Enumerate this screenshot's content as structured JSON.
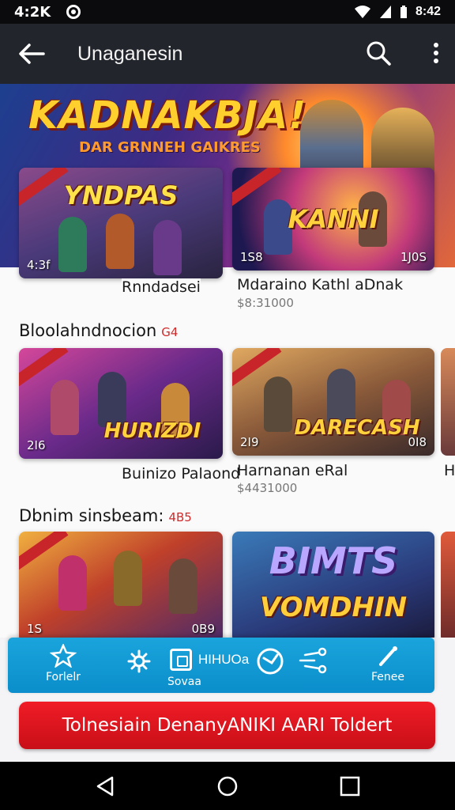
{
  "status_bar": {
    "time": "4:2K",
    "clock": "8:42"
  },
  "app_bar": {
    "title": "Unaganesin"
  },
  "hero": {
    "title": "KADNAKBJA!",
    "subtitle": "DAR GRNNEH GAIKRES"
  },
  "featured": {
    "cards": [
      {
        "logo": "YNDPAS",
        "left_num": "4:3f",
        "right_num": "",
        "name": "Rnndadsei",
        "price": ""
      },
      {
        "logo": "KANNI",
        "left_num": "1S8",
        "right_num": "1J0S",
        "name": "Mdaraino Kathl aDnak",
        "price": "$8:31000"
      }
    ]
  },
  "section1": {
    "title": "Bloolahndnocion",
    "count": "G4",
    "cards": [
      {
        "logo": "HURIZDI",
        "left_num": "2I6",
        "right_num": "",
        "name": "Buinizo Palaond",
        "price": ""
      },
      {
        "logo": "DARECASH",
        "left_num": "2I9",
        "right_num": "0I8",
        "name": "Harnanan eRal",
        "price": "$4431000"
      }
    ],
    "peek_name": "H"
  },
  "section2": {
    "title": "Dbnim sinsbeam:",
    "count": "4B5",
    "cards": [
      {
        "logo": "",
        "left_num": "1S",
        "right_num": "0B9",
        "name": "",
        "price": ""
      },
      {
        "logo": "BIMTS",
        "logo2": "VOMDHIN",
        "left_num": "",
        "right_num": "",
        "name": "",
        "price": ""
      }
    ]
  },
  "bottom_tabs": {
    "left_label": "Forlelr",
    "middle_label": "Sovaa",
    "center_text": "HIHUOa",
    "right_label": "Fenee"
  },
  "cta": {
    "label": "Tolnesiain DenanyANIKI AARI Toldert"
  },
  "colors": {
    "app_bar": "#23252d",
    "tabs": "#0b8ecb",
    "cta": "#e0121c"
  }
}
